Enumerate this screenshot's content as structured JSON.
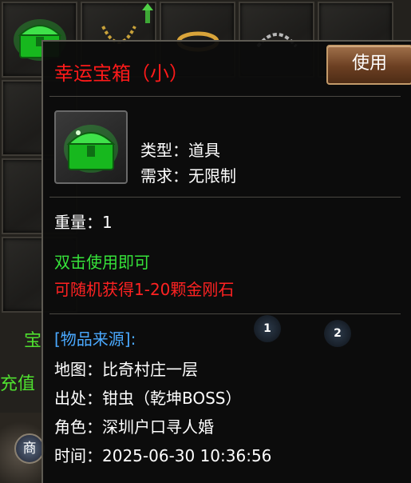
{
  "tooltip": {
    "title": "幸运宝箱（小）",
    "use_label": "使用",
    "type_line": "类型：道具",
    "require_line": "需求：无限制",
    "weight_line": "重量：1",
    "desc_use": "双击使用即可",
    "desc_reward": "可随机获得1-20颗金刚石",
    "source_header": "[物品来源]:",
    "map_line": "地图：比奇村庄一层",
    "origin_line": "出处：钳虫（乾坤BOSS）",
    "role_line": "角色：深圳户口寻人婚",
    "time_line": "时间：2025-06-30 10:36:56",
    "tab_1": "1",
    "tab_2": "2",
    "item_icon": "green-treasure-chest-icon"
  },
  "background": {
    "side_label_top": "宝",
    "side_label_bottom": "充值",
    "shop_label": "商"
  },
  "colors": {
    "title": "#ff1a1a",
    "green_text": "#36e23a",
    "red_text": "#ff2222",
    "blue_text": "#4aa9ff",
    "button": "#6b3f22"
  }
}
